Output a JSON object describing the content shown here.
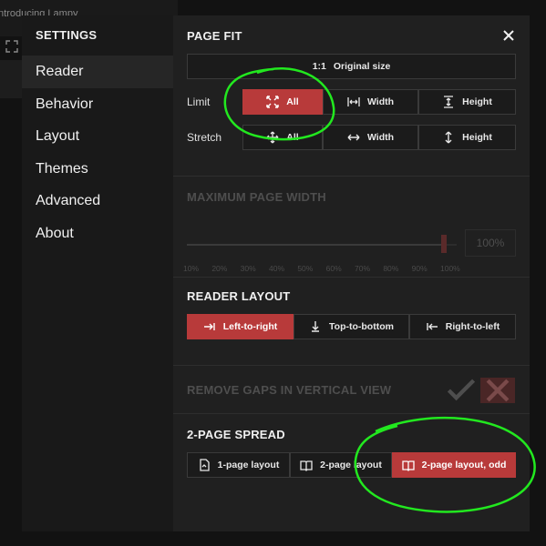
{
  "background": {
    "title": "ntroducing Lampy"
  },
  "settings": {
    "title": "SETTINGS",
    "nav": [
      {
        "label": "Reader",
        "active": true
      },
      {
        "label": "Behavior"
      },
      {
        "label": "Layout"
      },
      {
        "label": "Themes"
      },
      {
        "label": "Advanced"
      },
      {
        "label": "About"
      }
    ]
  },
  "page_fit": {
    "title": "PAGE FIT",
    "original_size_prefix": "1:1",
    "original_size_label": "Original size",
    "limit": {
      "label": "Limit",
      "options": [
        "All",
        "Width",
        "Height"
      ],
      "selected": "All"
    },
    "stretch": {
      "label": "Stretch",
      "options": [
        "All",
        "Width",
        "Height"
      ],
      "selected": null
    }
  },
  "max_width": {
    "title": "MAXIMUM PAGE WIDTH",
    "value": "100%",
    "ticks": [
      "10%",
      "20%",
      "30%",
      "40%",
      "50%",
      "60%",
      "70%",
      "80%",
      "90%",
      "100%"
    ]
  },
  "reader_layout": {
    "title": "READER LAYOUT",
    "options": [
      "Left-to-right",
      "Top-to-bottom",
      "Right-to-left"
    ],
    "selected": "Left-to-right"
  },
  "remove_gaps": {
    "title": "REMOVE GAPS IN VERTICAL VIEW"
  },
  "spread": {
    "title": "2-PAGE SPREAD",
    "options": [
      "1-page layout",
      "2-page layout",
      "2-page layout, odd"
    ],
    "selected": "2-page layout, odd"
  },
  "colors": {
    "accent": "#b83a3a",
    "annotation": "#22e81f"
  }
}
